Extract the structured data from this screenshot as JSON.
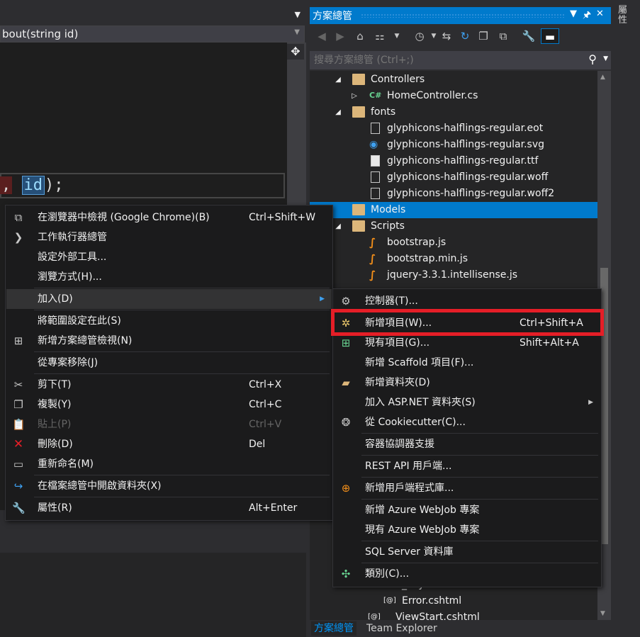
{
  "editor": {
    "nav_method": "bout(string id)",
    "code_prefix": ",",
    "code_param": "id",
    "code_suffix": ");"
  },
  "solution_explorer": {
    "title": "方案總管",
    "search_placeholder": "搜尋方案總管 (Ctrl+;)",
    "tree": [
      {
        "label": "Controllers",
        "type": "folder",
        "expander": "open"
      },
      {
        "label": "HomeController.cs",
        "type": "cs",
        "expander": "closed"
      },
      {
        "label": "fonts",
        "type": "folder",
        "expander": "open"
      },
      {
        "label": "glyphicons-halflings-regular.eot",
        "type": "file",
        "expander": ""
      },
      {
        "label": "glyphicons-halflings-regular.svg",
        "type": "svg",
        "expander": ""
      },
      {
        "label": "glyphicons-halflings-regular.ttf",
        "type": "ttf",
        "expander": ""
      },
      {
        "label": "glyphicons-halflings-regular.woff",
        "type": "file",
        "expander": ""
      },
      {
        "label": "glyphicons-halflings-regular.woff2",
        "type": "file",
        "expander": ""
      },
      {
        "label": "Models",
        "type": "folder",
        "expander": "",
        "selected": true
      },
      {
        "label": "Scripts",
        "type": "folder",
        "expander": "open"
      },
      {
        "label": "bootstrap.js",
        "type": "js",
        "expander": ""
      },
      {
        "label": "bootstrap.min.js",
        "type": "js",
        "expander": ""
      },
      {
        "label": "jquery-3.3.1.intellisense.js",
        "type": "js",
        "expander": ""
      }
    ],
    "bottom_rows": [
      {
        "label": "_Layout.cshtml"
      },
      {
        "label": "Error.cshtml"
      },
      {
        "label": "_ViewStart.cshtml"
      }
    ],
    "tabs": [
      "方案總管",
      "Team Explorer"
    ]
  },
  "right_edge_label": "屬性",
  "context_menu": {
    "items": [
      {
        "label": "在瀏覽器中檢視 (Google Chrome)(B)",
        "shortcut": "Ctrl+Shift+W",
        "icon": "browser-view-icon"
      },
      {
        "label": "工作執行器總管",
        "shortcut": "",
        "icon": "chevron-right-icon"
      },
      {
        "label": "設定外部工具...",
        "shortcut": "",
        "icon": ""
      },
      {
        "label": "瀏覽方式(H)...",
        "shortcut": "",
        "icon": ""
      },
      {
        "label": "加入(D)",
        "shortcut": "",
        "icon": "",
        "submenu": true,
        "hover": true
      },
      {
        "label": "將範圍設定在此(S)",
        "shortcut": "",
        "icon": ""
      },
      {
        "label": "新增方案總管檢視(N)",
        "shortcut": "",
        "icon": "new-view-icon"
      },
      {
        "label": "從專案移除(J)",
        "shortcut": "",
        "icon": ""
      },
      {
        "label": "剪下(T)",
        "shortcut": "Ctrl+X",
        "icon": "scissors-icon"
      },
      {
        "label": "複製(Y)",
        "shortcut": "Ctrl+C",
        "icon": "copy-icon"
      },
      {
        "label": "貼上(P)",
        "shortcut": "Ctrl+V",
        "icon": "paste-icon",
        "disabled": true
      },
      {
        "label": "刪除(D)",
        "shortcut": "Del",
        "icon": "delete-x-icon"
      },
      {
        "label": "重新命名(M)",
        "shortcut": "",
        "icon": "rename-icon"
      },
      {
        "label": "在檔案總管中開啟資料夾(X)",
        "shortcut": "",
        "icon": "refresh-folder-icon"
      },
      {
        "label": "屬性(R)",
        "shortcut": "Alt+Enter",
        "icon": "wrench-icon"
      }
    ]
  },
  "submenu": {
    "items": [
      {
        "label": "控制器(T)...",
        "shortcut": "",
        "icon": "controller-icon"
      },
      {
        "label": "新增項目(W)...",
        "shortcut": "Ctrl+Shift+A",
        "icon": "new-item-icon",
        "highlighted": true
      },
      {
        "label": "現有項目(G)...",
        "shortcut": "Shift+Alt+A",
        "icon": "existing-item-icon"
      },
      {
        "label": "新增 Scaffold 項目(F)...",
        "shortcut": "",
        "icon": ""
      },
      {
        "label": "新增資料夾(D)",
        "shortcut": "",
        "icon": "new-folder-icon"
      },
      {
        "label": "加入 ASP.NET 資料夾(S)",
        "shortcut": "",
        "icon": "",
        "submenu": true
      },
      {
        "label": "從 Cookiecutter(C)...",
        "shortcut": "",
        "icon": "cookiecutter-icon"
      },
      {
        "label": "容器協調器支援",
        "shortcut": "",
        "icon": ""
      },
      {
        "label": "REST API 用戶端...",
        "shortcut": "",
        "icon": ""
      },
      {
        "label": "新增用戶端程式庫...",
        "shortcut": "",
        "icon": "client-library-icon"
      },
      {
        "label": "新增 Azure WebJob 專案",
        "shortcut": "",
        "icon": ""
      },
      {
        "label": "現有 Azure WebJob 專案",
        "shortcut": "",
        "icon": ""
      },
      {
        "label": "SQL Server 資料庫",
        "shortcut": "",
        "icon": ""
      },
      {
        "label": "類別(C)...",
        "shortcut": "",
        "icon": "class-icon"
      }
    ]
  }
}
